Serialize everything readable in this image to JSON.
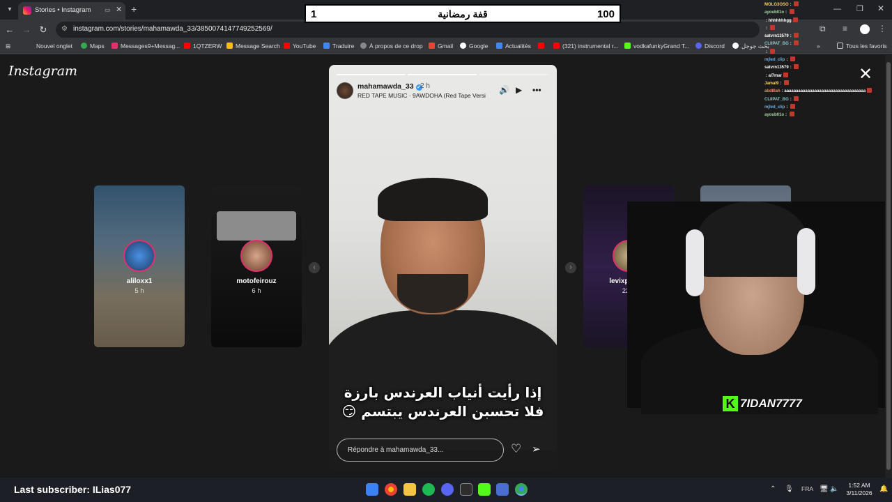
{
  "browser": {
    "tab_title": "Stories • Instagram",
    "url": "instagram.com/stories/mahamawda_33/3850074147749252569/",
    "bookmarks": [
      "Nouvel onglet",
      "Maps",
      "Messages9+Messag...",
      "1QTZERW",
      "Message Search",
      "YouTube",
      "Traduire",
      "À propos de ce drop",
      "Gmail",
      "Google",
      "Actualités",
      "(321) instrumental r...",
      "vodkafunkyGrand T...",
      "Discord",
      "بحث جوجل"
    ],
    "all_bookmarks": "Tous les favoris"
  },
  "instagram": {
    "logo": "Instagram",
    "left_stories": [
      {
        "name": "aliloxx1",
        "time": "5 h"
      },
      {
        "name": "motofeirouz",
        "time": "6 h"
      }
    ],
    "right_stories": [
      {
        "name": "levixproject",
        "time": "22 h"
      }
    ],
    "story": {
      "username": "mahamawda_33",
      "time": "2 h",
      "music": "RED TAPE MUSIC · 9AWDOHA (Red Tape Versi",
      "caption_line1": "إذا رأيت أنياب العرندس بارزة",
      "caption_line2": "فلا تحسبن العرندس يبتسم 😏",
      "reply_placeholder": "Répondre à mahamawda_33..."
    }
  },
  "overlay": {
    "counter_left": "1",
    "counter_title": "قفة رمضانية",
    "counter_right": "100",
    "streamer_name": "7IDAN7777",
    "kick_logo": "K",
    "last_subscriber": "Last subscriber: ILias077",
    "chat": [
      {
        "user": "MOLG3OSO",
        "msg": "",
        "color": "#ffd54f"
      },
      {
        "user": "ayoub01o",
        "msg": "",
        "color": "#a5d6a7"
      },
      {
        "user": "",
        "msg": "hhhhhhhgg",
        "color": "#ef5350"
      },
      {
        "user": "",
        "msg": "",
        "color": "#ce93d8"
      },
      {
        "user": "satvrn13579",
        "msg": "",
        "color": "#ffffff"
      },
      {
        "user": "CLIIPAT_BG",
        "msg": "",
        "color": "#80cbc4"
      },
      {
        "user": "",
        "msg": "",
        "color": "#90caf9"
      },
      {
        "user": "mjled_clip",
        "msg": "",
        "color": "#64b5f6"
      },
      {
        "user": "satvrn13579",
        "msg": "",
        "color": "#ffffff"
      },
      {
        "user": "",
        "msg": "al7mar",
        "color": "#7986cb"
      },
      {
        "user": "Jamal9",
        "msg": "",
        "color": "#ffd54f"
      },
      {
        "user": "abd8lah",
        "msg": "aaaaaaaaaaaaaaaaaaaaaaaaaaaaaaaaaaa",
        "color": "#ff8a65"
      },
      {
        "user": "CLIIPAT_BG",
        "msg": "",
        "color": "#80cbc4"
      },
      {
        "user": "mjled_clip",
        "msg": "",
        "color": "#64b5f6"
      },
      {
        "user": "ayoub01o",
        "msg": "",
        "color": "#a5d6a7"
      }
    ]
  },
  "taskbar": {
    "language": "FRA",
    "time": "1:52 AM",
    "date": "3/11/2026"
  },
  "colors": {
    "kick_green": "#53fc18",
    "ig_gradient_start": "#f9a825",
    "ig_gradient_end": "#7b1fa2"
  }
}
